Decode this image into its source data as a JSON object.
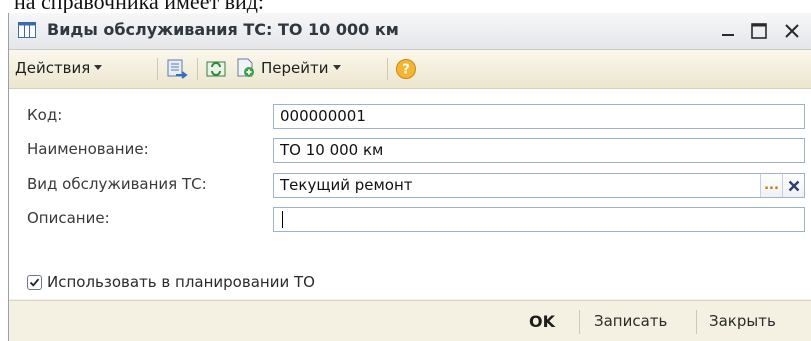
{
  "document": {
    "clipped_text": "на  справочника имеет вид:"
  },
  "window": {
    "title": "Виды обслуживания ТС: ТО 10 000 км"
  },
  "toolbar": {
    "actions_label": "Действия",
    "goto_label": "Перейти"
  },
  "form": {
    "fields": [
      {
        "label": "Код:",
        "value": "000000001"
      },
      {
        "label": "Наименование:",
        "value": "ТО 10 000 км"
      },
      {
        "label": "Вид обслуживания ТС:",
        "value": "Текущий ремонт"
      },
      {
        "label": "Описание:",
        "value": ""
      }
    ],
    "checkbox": {
      "label": "Использовать в планировании ТО",
      "checked": true
    },
    "select_button_label": "..."
  },
  "buttons": {
    "ok_label": "OK",
    "save_label": "Записать",
    "close_label": "Закрыть"
  },
  "colors": {
    "accent_orange": "#f0a020",
    "title_bar": "#e4e6ea",
    "toolbar_bg": "#f3eedb"
  }
}
